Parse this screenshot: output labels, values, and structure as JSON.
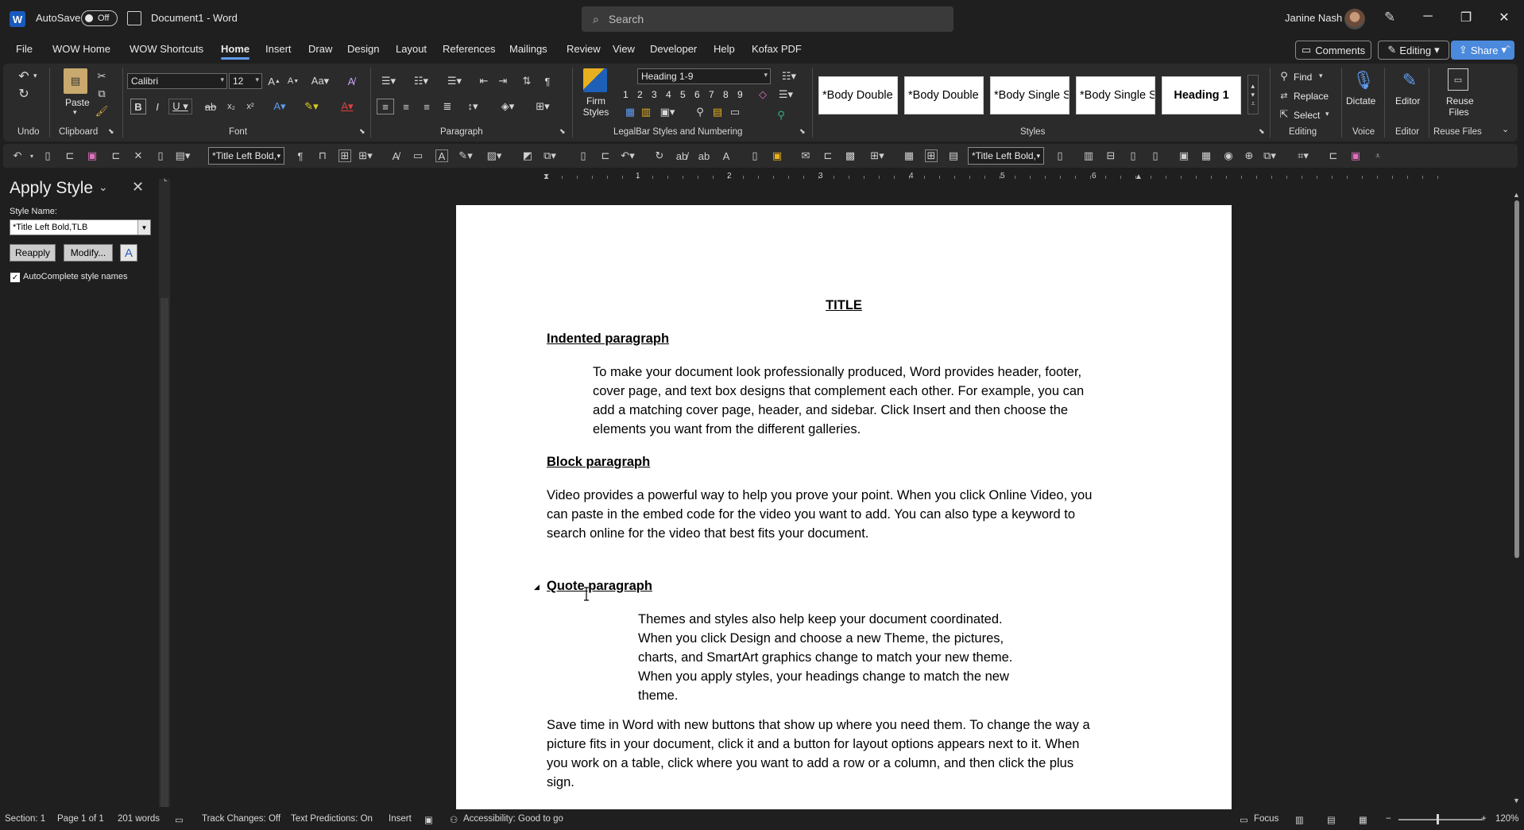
{
  "titlebar": {
    "autosave_label": "AutoSave",
    "autosave_state": "Off",
    "document_title": "Document1  -  Word",
    "search_placeholder": "Search",
    "user_name": "Janine Nash"
  },
  "menu": {
    "tabs": [
      "File",
      "WOW Home",
      "WOW Shortcuts",
      "Home",
      "Insert",
      "Draw",
      "Design",
      "Layout",
      "References",
      "Mailings",
      "Review",
      "View",
      "Developer",
      "Help",
      "Kofax PDF"
    ],
    "active_tab": "Home",
    "comments_label": "Comments",
    "editing_label": "Editing",
    "share_label": "Share"
  },
  "ribbon": {
    "groups": {
      "undo": "Undo",
      "clipboard": "Clipboard",
      "font": "Font",
      "paragraph": "Paragraph",
      "legalbar": "LegalBar Styles and Numbering",
      "styles": "Styles",
      "editing": "Editing",
      "voice": "Voice",
      "editor": "Editor",
      "reuse": "Reuse Files"
    },
    "paste_label": "Paste",
    "font_name": "Calibri",
    "font_size": "12",
    "heading_combo": "Heading 1-9",
    "firm_styles_label": "Firm Styles",
    "numbering_levels": [
      "1",
      "2",
      "3",
      "4",
      "5",
      "6",
      "7",
      "8",
      "9"
    ],
    "style_gallery": [
      "*Body Double",
      "*Body Double",
      "*Body Single S",
      "*Body Single S",
      "Heading 1"
    ],
    "find_label": "Find",
    "replace_label": "Replace",
    "select_label": "Select",
    "dictate_label": "Dictate",
    "editor_label": "Editor",
    "reuse_files_label": "Reuse Files"
  },
  "qat": {
    "style_combo_1": "*Title Left Bold,",
    "style_combo_2": "*Title Left Bold,"
  },
  "apply_styles": {
    "title": "Apply Styles",
    "style_name_label": "Style Name:",
    "style_name_value": "*Title Left Bold,TLB",
    "reapply_label": "Reapply",
    "modify_label": "Modify...",
    "autocomplete_label": "AutoComplete style names"
  },
  "ruler": {
    "numbers": [
      "1",
      "2",
      "3",
      "4",
      "5",
      "6"
    ]
  },
  "document": {
    "title": "TITLE",
    "h_indented": "Indented paragraph",
    "p_indented": [
      "To make your document look professionally produced, Word provides header, footer,",
      "cover page, and text box designs that complement each other. For example, you can",
      "add a matching cover page, header, and sidebar. Click Insert and then choose the",
      "elements you want from the different galleries."
    ],
    "h_block": "Block paragraph",
    "p_block": [
      "Video provides a powerful way to help you prove your point. When you click Online Video, you",
      "can paste in the embed code for the video you want to add. You can also type a keyword to",
      "search online for the video that best fits your document."
    ],
    "h_quote": "Quote paragraph",
    "p_quote": [
      "Themes and styles also help keep your document coordinated.",
      "When you click Design and choose a new Theme, the pictures,",
      "charts, and SmartArt graphics change to match your new theme.",
      "When you apply styles, your headings change to match the new",
      "theme."
    ],
    "p_last": [
      "Save time in Word with new buttons that show up where you need them. To change the way a",
      "picture fits in your document, click it and a button for layout options appears next to it. When",
      "you work on a table, click where you want to add a row or a column, and then click the plus",
      "sign."
    ]
  },
  "status": {
    "section": "Section: 1",
    "page": "Page 1 of 1",
    "words": "201 words",
    "track_changes": "Track Changes: Off",
    "text_predictions": "Text Predictions: On",
    "insert_mode": "Insert",
    "accessibility": "Accessibility: Good to go",
    "focus": "Focus",
    "zoom": "120%"
  }
}
